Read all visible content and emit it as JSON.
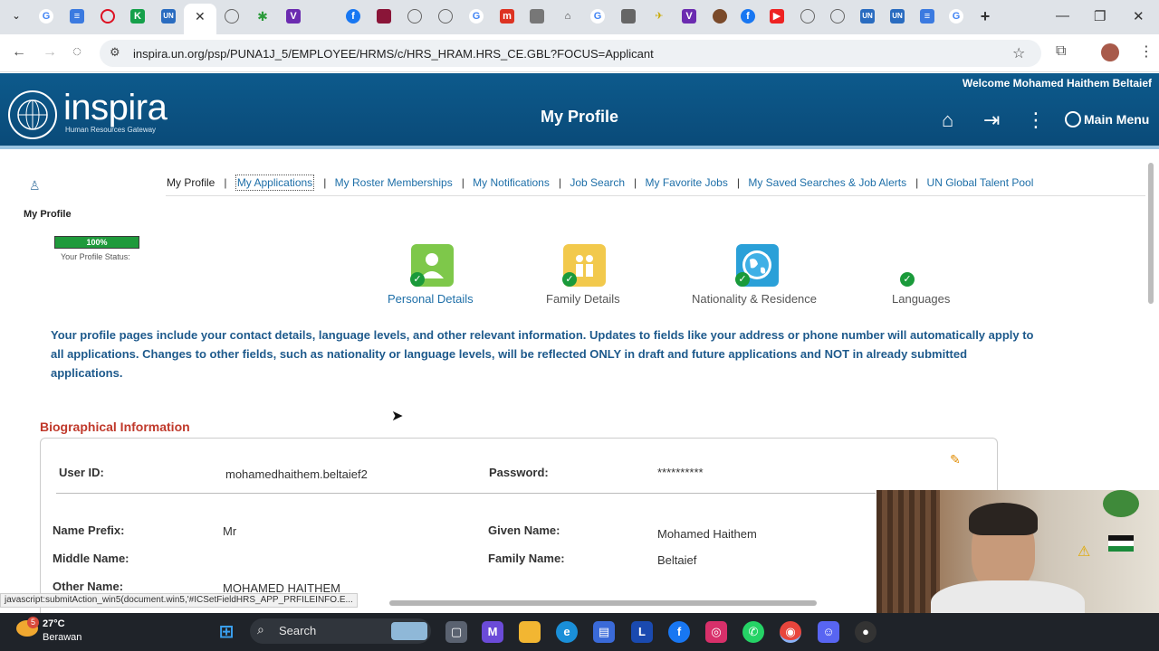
{
  "browser": {
    "url": "inspira.un.org/psp/PUNA1J_5/EMPLOYEE/HRMS/c/HRS_HRAM.HRS_CE.GBL?FOCUS=Applicant",
    "status_link": "javascript:submitAction_win5(document.win5,'#ICSetFieldHRS_APP_PRFILEINFO.E..."
  },
  "header": {
    "logo_text": "inspira",
    "logo_sub": "Human Resources Gateway",
    "welcome": "Welcome Mohamed Haithem Beltaief",
    "page_title": "My Profile",
    "main_menu": "Main Menu"
  },
  "nav": {
    "items": [
      {
        "label": "My Profile"
      },
      {
        "label": "My Applications"
      },
      {
        "label": "My Roster Memberships"
      },
      {
        "label": "My Notifications"
      },
      {
        "label": "Job Search"
      },
      {
        "label": "My Favorite Jobs"
      },
      {
        "label": "My Saved Searches & Job Alerts"
      },
      {
        "label": "UN Global Talent Pool"
      }
    ]
  },
  "profile": {
    "section_label": "My Profile",
    "progress_text": "100%",
    "progress_value": 1.0,
    "progress_label": "Your Profile Status:",
    "cards": [
      {
        "label": "Personal Details",
        "icon": "person-icon",
        "color": "#7ec84a"
      },
      {
        "label": "Family Details",
        "icon": "family-icon",
        "color": "#f2c94c"
      },
      {
        "label": "Nationality & Residence",
        "icon": "globe-icon",
        "color": "#2aa0d8"
      },
      {
        "label": "Languages",
        "icon": "languages-icon",
        "color": "#1a9a3a"
      }
    ],
    "info": "Your profile pages include your contact details, language levels, and other relevant information. Updates to fields like your address or phone number will automatically apply to all applications. Changes to other fields, such as nationality or language levels, will be reflected ONLY in draft and future applications and NOT in already submitted applications."
  },
  "bio": {
    "title": "Biographical Information",
    "user_id_label": "User ID:",
    "user_id": "mohamedhaithem.beltaief2",
    "password_label": "Password:",
    "password": "**********",
    "prefix_label": "Name Prefix:",
    "prefix": "Mr",
    "given_label": "Given Name:",
    "given": "Mohamed Haithem",
    "middle_label": "Middle Name:",
    "family_label": "Family Name:",
    "family": "Beltaief",
    "other_label": "Other Name:",
    "other": "MOHAMED HAITHEM"
  },
  "taskbar": {
    "temp": "27°C",
    "weather": "Berawan",
    "search": "Search",
    "badge": "5"
  }
}
